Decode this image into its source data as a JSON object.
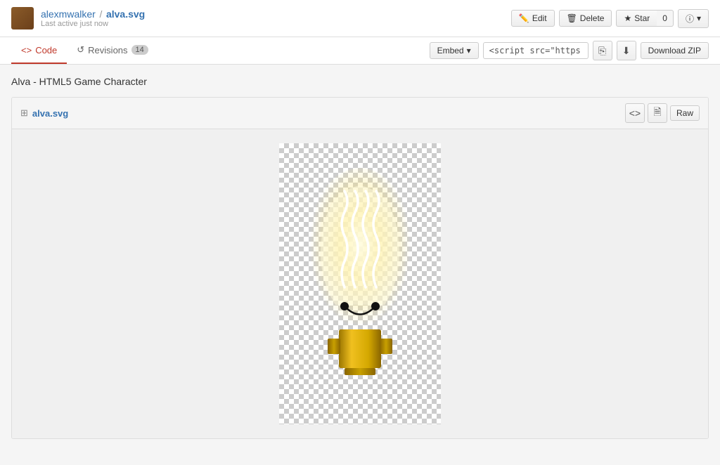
{
  "header": {
    "username": "alexmwalker",
    "separator": "/",
    "repo_name": "alva.svg",
    "last_active": "Last active just now",
    "edit_label": "Edit",
    "delete_label": "Delete",
    "star_label": "Star",
    "star_count": "0",
    "info_label": "ⓘ"
  },
  "tabs": {
    "code_label": "Code",
    "revisions_label": "Revisions",
    "revisions_count": "14",
    "embed_label": "Embed",
    "script_value": "<script src=\"https://gi",
    "download_label": "Download ZIP"
  },
  "main": {
    "page_title": "Alva - HTML5 Game Character",
    "file_name": "alva.svg",
    "raw_label": "Raw"
  }
}
